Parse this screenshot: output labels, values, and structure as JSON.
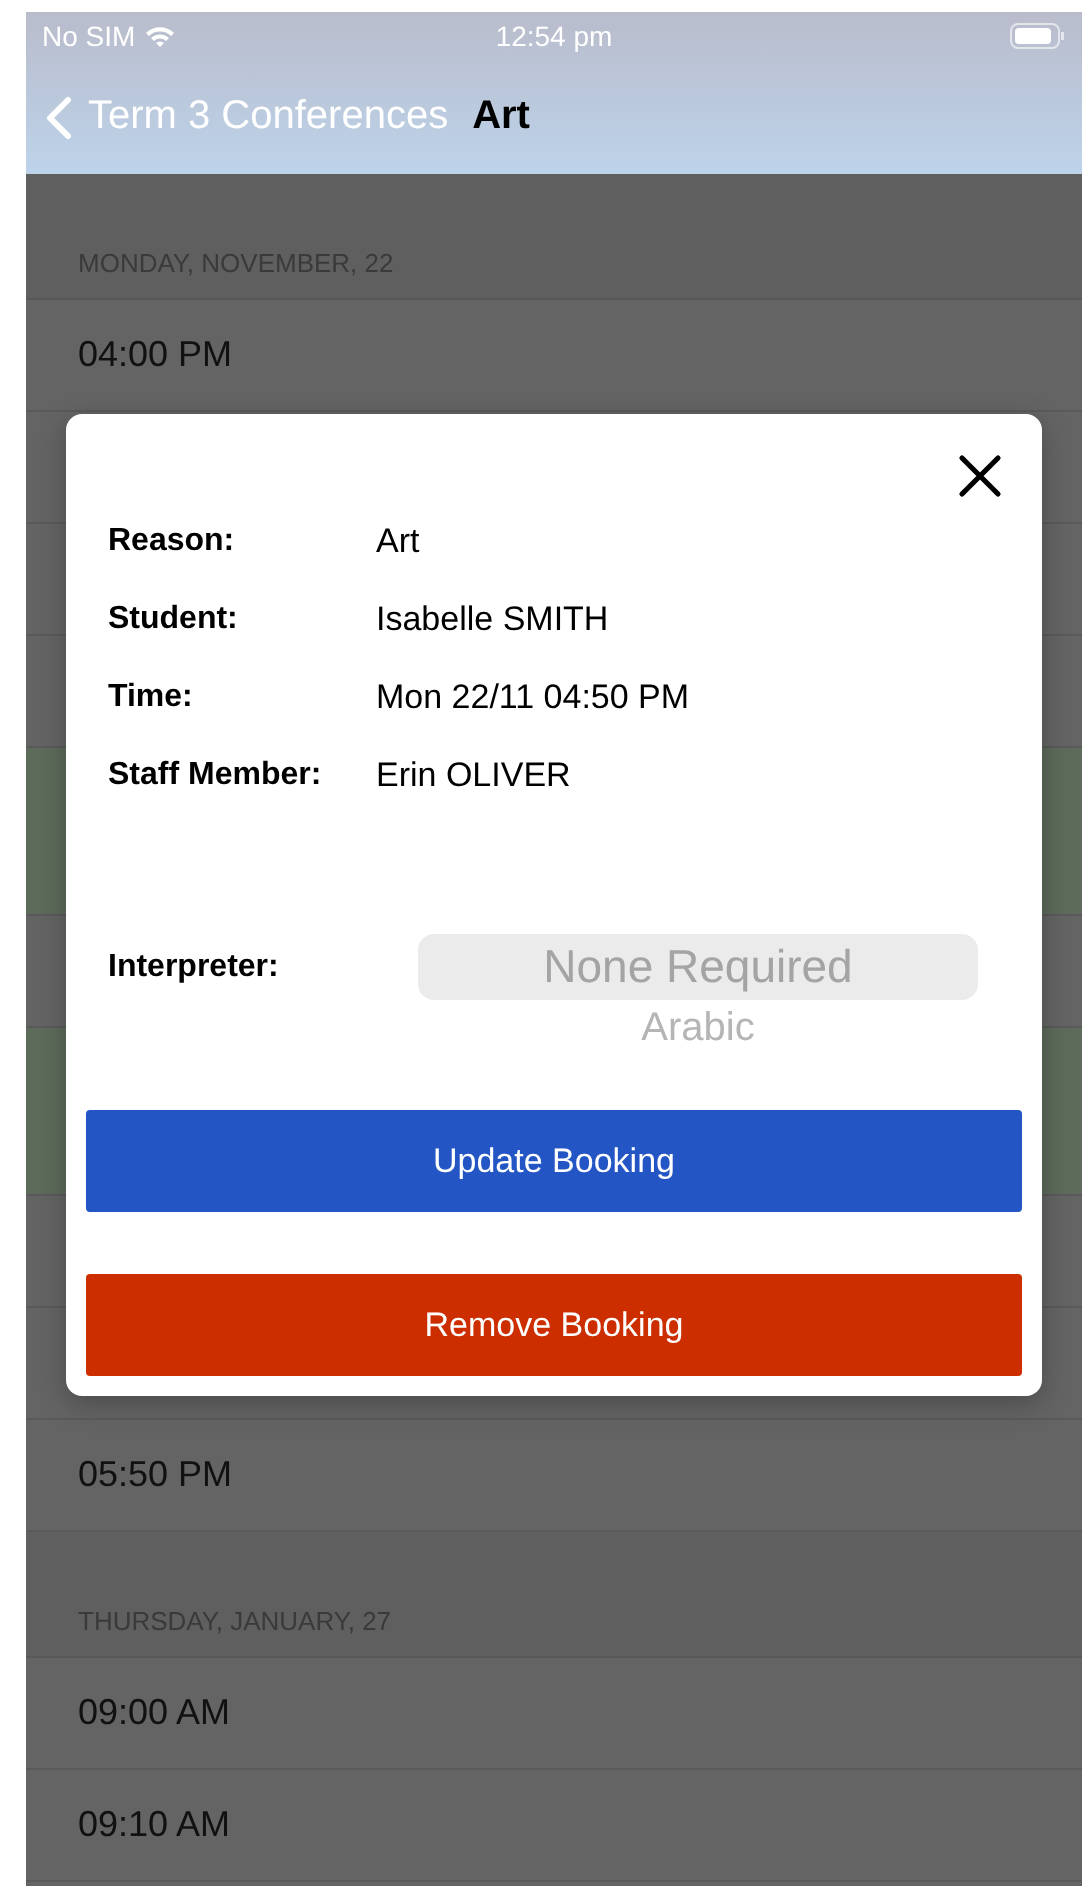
{
  "status_bar": {
    "carrier": "No SIM",
    "time": "12:54 pm"
  },
  "nav": {
    "back_label": "Term 3 Conferences",
    "title": "Art"
  },
  "sections": [
    {
      "header": "MONDAY, NOVEMBER, 22",
      "rows": [
        {
          "time": "04:00 PM",
          "booked": false
        },
        {
          "booked": false
        },
        {
          "booked": false
        },
        {
          "booked": false
        },
        {
          "booked": true
        },
        {
          "booked": false
        },
        {
          "booked": true
        },
        {
          "booked": false
        },
        {
          "booked": false
        },
        {
          "time": "05:50 PM",
          "booked": false
        }
      ]
    },
    {
      "header": "THURSDAY, JANUARY, 27",
      "rows": [
        {
          "time": "09:00 AM",
          "booked": false
        },
        {
          "time": "09:10 AM",
          "booked": false
        }
      ]
    }
  ],
  "dialog": {
    "details": [
      {
        "label": "Reason:",
        "value": "Art"
      },
      {
        "label": "Student:",
        "value": "Isabelle SMITH"
      },
      {
        "label": "Time:",
        "value": "Mon 22/11 04:50 PM"
      },
      {
        "label": "Staff Member:",
        "value": "Erin OLIVER"
      }
    ],
    "interpreter": {
      "label": "Interpreter:",
      "options": [
        {
          "label": "None Required",
          "selected": true
        },
        {
          "label": "Arabic",
          "selected": false
        }
      ]
    },
    "buttons": [
      {
        "label": "Update Booking",
        "kind": "primary"
      },
      {
        "label": "Remove Booking",
        "kind": "danger"
      }
    ]
  }
}
